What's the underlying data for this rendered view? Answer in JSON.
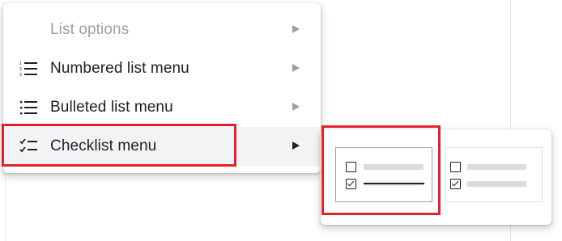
{
  "menu": {
    "items": [
      {
        "label": "List options",
        "icon": "none",
        "disabled": true
      },
      {
        "label": "Numbered list menu",
        "icon": "numbered-list-icon"
      },
      {
        "label": "Bulleted list menu",
        "icon": "bulleted-list-icon"
      },
      {
        "label": "Checklist menu",
        "icon": "checklist-icon",
        "highlighted": true
      }
    ]
  },
  "submenu": {
    "options": [
      {
        "style": "strikethrough-checked-items",
        "selected": true
      },
      {
        "style": "plain-checked-items",
        "selected": false
      }
    ]
  },
  "colors": {
    "highlight_box": "#e3222d",
    "hover_bg": "#f1f3f4",
    "disabled_text": "#9aa0a6",
    "text": "#202124",
    "placeholder_bar": "#dadce0"
  }
}
